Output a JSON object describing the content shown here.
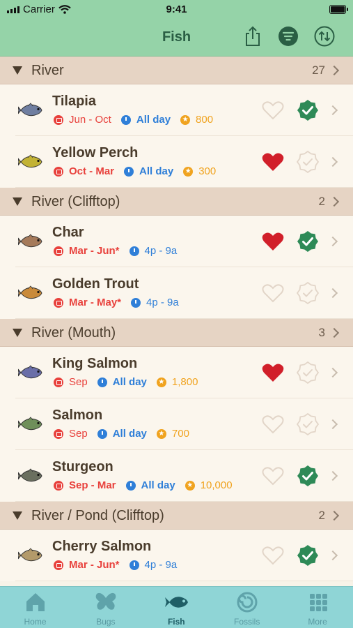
{
  "status": {
    "carrier": "Carrier",
    "time": "9:41"
  },
  "nav": {
    "title": "Fish"
  },
  "sections": [
    {
      "name": "River",
      "count": "27",
      "rows": [
        {
          "name": "Tilapia",
          "season": "Jun - Oct",
          "season_bold": false,
          "hours": "All day",
          "hours_bold": true,
          "price": "800",
          "favorite": false,
          "caught": true,
          "fish_color": "#6f7ea0"
        },
        {
          "name": "Yellow Perch",
          "season": "Oct - Mar",
          "season_bold": true,
          "hours": "All day",
          "hours_bold": true,
          "price": "300",
          "favorite": true,
          "caught": false,
          "fish_color": "#c2b234"
        }
      ]
    },
    {
      "name": "River (Clifftop)",
      "count": "2",
      "rows": [
        {
          "name": "Char",
          "season": "Mar - Jun*",
          "season_bold": true,
          "hours": "4p - 9a",
          "hours_bold": false,
          "price": "",
          "favorite": true,
          "caught": true,
          "fish_color": "#a57a5a"
        },
        {
          "name": "Golden Trout",
          "season": "Mar - May*",
          "season_bold": true,
          "hours": "4p - 9a",
          "hours_bold": false,
          "price": "",
          "favorite": false,
          "caught": false,
          "fish_color": "#c98a3a"
        }
      ]
    },
    {
      "name": "River (Mouth)",
      "count": "3",
      "rows": [
        {
          "name": "King Salmon",
          "season": "Sep",
          "season_bold": false,
          "hours": "All day",
          "hours_bold": true,
          "price": "1,800",
          "favorite": true,
          "caught": false,
          "fish_color": "#6a6ea8"
        },
        {
          "name": "Salmon",
          "season": "Sep",
          "season_bold": false,
          "hours": "All day",
          "hours_bold": true,
          "price": "700",
          "favorite": false,
          "caught": false,
          "fish_color": "#6f8f5a"
        },
        {
          "name": "Sturgeon",
          "season": "Sep - Mar",
          "season_bold": true,
          "hours": "All day",
          "hours_bold": true,
          "price": "10,000",
          "favorite": false,
          "caught": true,
          "fish_color": "#6a6f5f"
        }
      ]
    },
    {
      "name": "River / Pond (Clifftop)",
      "count": "2",
      "rows": [
        {
          "name": "Cherry Salmon",
          "season": "Mar - Jun*",
          "season_bold": true,
          "hours": "4p - 9a",
          "hours_bold": false,
          "price": "",
          "favorite": false,
          "caught": true,
          "fish_color": "#b39a6a"
        }
      ]
    }
  ],
  "tabs": [
    {
      "label": "Home",
      "icon": "home-icon",
      "active": false
    },
    {
      "label": "Bugs",
      "icon": "butterfly-icon",
      "active": false
    },
    {
      "label": "Fish",
      "icon": "fish-icon",
      "active": true
    },
    {
      "label": "Fossils",
      "icon": "fossil-icon",
      "active": false
    },
    {
      "label": "More",
      "icon": "grid-icon",
      "active": false
    }
  ],
  "colors": {
    "header": "#95d3a8",
    "section": "#e6d4c4",
    "tabbar": "#8fd5d6",
    "heart": "#d11f2a",
    "caught": "#2e8a57"
  }
}
